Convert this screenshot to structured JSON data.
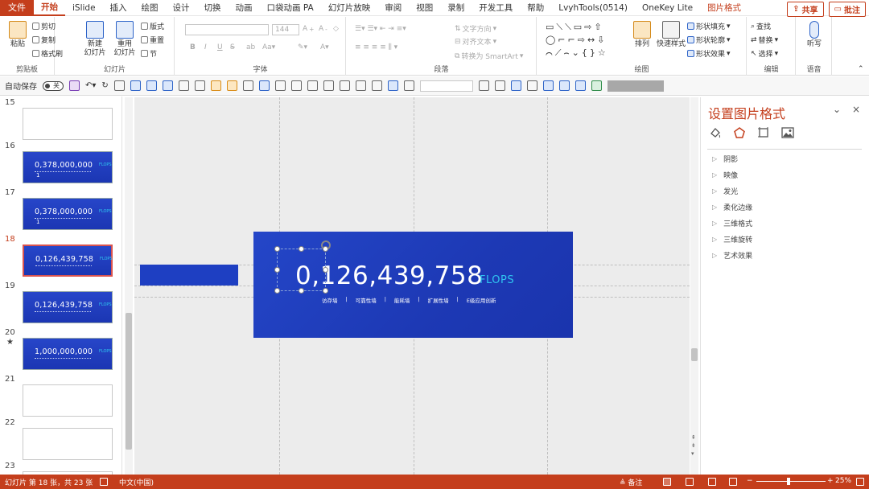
{
  "menu": {
    "file": "文件",
    "tabs": [
      "开始",
      "iSlide",
      "插入",
      "绘图",
      "设计",
      "切换",
      "动画",
      "口袋动画 PA",
      "幻灯片放映",
      "审阅",
      "视图",
      "录制",
      "开发工具",
      "帮助",
      "LvyhTools(0514)",
      "OneKey Lite",
      "图片格式"
    ],
    "active_index": 0,
    "share": "共享",
    "comment": "批注"
  },
  "ribbon": {
    "clipboard": {
      "paste": "粘贴",
      "cut": "剪切",
      "copy": "复制",
      "format_painter": "格式刷",
      "label": "剪贴板"
    },
    "slides": {
      "new_slide": "新建\n幻灯片",
      "reuse_slide": "重用\n幻灯片",
      "layout": "版式",
      "reset": "重置",
      "section": "节",
      "label": "幻灯片"
    },
    "font": {
      "size": "144",
      "bold": "B",
      "italic": "I",
      "underline": "U",
      "strike": "S",
      "label": "字体"
    },
    "paragraph": {
      "text_direction": "文字方向",
      "align_text": "对齐文本",
      "smartart": "转换为 SmartArt",
      "label": "段落"
    },
    "drawing": {
      "arrange": "排列",
      "quick_styles": "快速样式",
      "shape_fill": "形状填充",
      "shape_outline": "形状轮廓",
      "shape_effects": "形状效果",
      "label": "绘图"
    },
    "editing": {
      "find": "查找",
      "replace": "替换",
      "select": "选择",
      "label": "编辑"
    },
    "voice": {
      "dictate": "听写",
      "label": "语音"
    }
  },
  "qat": {
    "autosave": "自动保存",
    "toggle": "关"
  },
  "thumbnails": [
    {
      "num": "15",
      "type": "blank",
      "star": false
    },
    {
      "num": "16",
      "type": "blue",
      "title": "0,378,000,000",
      "flops": "FLOPS",
      "extra": "1",
      "star": false
    },
    {
      "num": "17",
      "type": "blue",
      "title": "0,378,000,000",
      "flops": "FLOPS",
      "extra": "1",
      "star": false
    },
    {
      "num": "18",
      "type": "blue",
      "title": "0,126,439,758",
      "flops": "FLOPS",
      "extra": "",
      "star": false,
      "active": true
    },
    {
      "num": "19",
      "type": "blue",
      "title": "0,126,439,758",
      "flops": "FLOPS",
      "extra": "",
      "star": false
    },
    {
      "num": "20",
      "type": "blue",
      "title": "1,000,000,000",
      "flops": "FLOPS",
      "extra": "",
      "star": true
    },
    {
      "num": "21",
      "type": "blank",
      "star": false
    },
    {
      "num": "22",
      "type": "blank",
      "star": false
    },
    {
      "num": "23",
      "type": "blank",
      "star": false
    }
  ],
  "slide": {
    "number": "0,126,439,758",
    "unit": "FLOPS",
    "subtitle_items": [
      "访存墙",
      "|",
      "可靠性墙",
      "|",
      "能耗墙",
      "|",
      "扩展性墙",
      "|",
      "E级应用创新"
    ]
  },
  "pane": {
    "title": "设置图片格式",
    "pin": "⌄",
    "close": "×",
    "items": [
      "阴影",
      "映像",
      "发光",
      "柔化边缘",
      "三维格式",
      "三维旋转",
      "艺术效果"
    ]
  },
  "status": {
    "slide_info": "幻灯片 第 18 张，共 23 张",
    "language": "中文(中国)",
    "notes": "备注",
    "zoom": "25%"
  },
  "colors": {
    "accent": "#c43e1c",
    "slide_blue": "#1e3fc2",
    "flops_cyan": "#2fc5f0"
  }
}
